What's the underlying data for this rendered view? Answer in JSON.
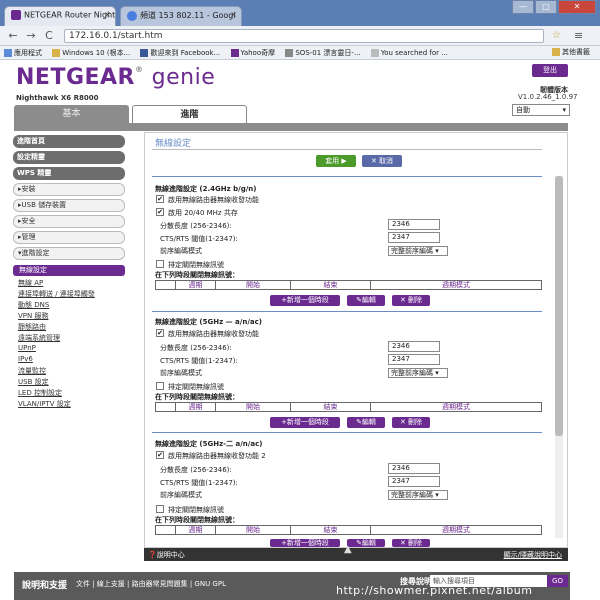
{
  "browser": {
    "tabs": [
      {
        "label": "NETGEAR Router Nighth",
        "close": "×"
      },
      {
        "label": "頻道 153 802.11 - Googl",
        "close": "×"
      }
    ],
    "url": "172.16.0.1/start.htm",
    "bookmarks": [
      "應用程式",
      "Windows 10 (根本...",
      "歡迎來到 Facebook...",
      "Yahoo奇摩",
      "SOS-01 漂言靈日-...",
      "You searched for ..."
    ],
    "bookmarks_other": "其他書籤",
    "window_controls": [
      "—",
      "□",
      "✕"
    ],
    "nav": [
      "←",
      "→",
      "C"
    ]
  },
  "header": {
    "brand": "NETGEAR",
    "genie": "genie",
    "reg": "®",
    "model": "Nighthawk X6 R8000",
    "logout": "登出",
    "firmware_label": "韌體版本",
    "firmware_version": "V1.0.2.46_1.0.97",
    "language": "自動",
    "tab_basic": "基本",
    "tab_advanced": "進階"
  },
  "sidebar": {
    "main_items": [
      "進階首頁",
      "設定精靈",
      "WPS 精靈"
    ],
    "sections": [
      "▸安裝",
      "▸USB 儲存裝置",
      "▸安全",
      "▸管理",
      "▾進階設定"
    ],
    "active": "無線設定",
    "sub_items": [
      "無線 AP",
      "連接埠轉送 / 連接埠觸發",
      "動態 DNS",
      "VPN 服務",
      "靜態路由",
      "遠端系統管理",
      "UPnP",
      "IPv6",
      "流量監控",
      "USB 設定",
      "LED 控制設定",
      "VLAN/IPTV 設定"
    ]
  },
  "main": {
    "title": "無線設定",
    "apply": "套用 ▶",
    "cancel": "✕ 取消",
    "bands": [
      {
        "title": "無線進階設定 (2.4GHz b/g/n)",
        "enable_radio": "啟用無線路由器無線收發功能",
        "coexist": "啟用 20/40 MHz 共存",
        "frag_label": "分散長度 (256-2346):",
        "frag_value": "2346",
        "rts_label": "CTS/RTS 閾值(1-2347):",
        "rts_value": "2347",
        "preamble_label": "前序編碼模式",
        "preamble_value": "完整前序編碼",
        "schedule_cb": "排定關閉無線訊號",
        "schedule_title": "在下列時段關閉無線訊號："
      },
      {
        "title": "無線進階設定 (5GHz — a/n/ac)",
        "enable_radio": "啟用無線路由器無線收發功能",
        "frag_label": "分散長度 (256-2346):",
        "frag_value": "2346",
        "rts_label": "CTS/RTS 閾值(1-2347):",
        "rts_value": "2347",
        "preamble_label": "前序編碼模式",
        "preamble_value": "完整前序編碼",
        "schedule_cb": "排定關閉無線訊號",
        "schedule_title": "在下列時段關閉無線訊號："
      },
      {
        "title": "無線進階設定 (5GHz-二 a/n/ac)",
        "enable_radio": "啟用無線路由器無線收發功能 2",
        "frag_label": "分散長度 (256-2346):",
        "frag_value": "2346",
        "rts_label": "CTS/RTS 閾值(1-2347):",
        "rts_value": "2347",
        "preamble_label": "前序編碼模式",
        "preamble_value": "完整前序編碼",
        "schedule_cb": "排定關閉無線訊號",
        "schedule_title": "在下列時段關閉無線訊號："
      }
    ],
    "schedule_columns": [
      "",
      "週期",
      "開始",
      "結束",
      "週期模式"
    ],
    "add_period": "+新增一個時段",
    "edit": "✎編輯",
    "delete": "✕ 刪除"
  },
  "helpbar": {
    "left": "說明中心",
    "right": "顯示/隱藏說明中心"
  },
  "footer": {
    "support": "說明和支援",
    "links": "文件 | 線上支援 | 路由器常見問題集 | GNU GPL",
    "search_label": "搜尋說明",
    "search_placeholder": "輸入搜尋項目",
    "go": "GO"
  },
  "watermark": "http://showmer.pixnet.net/album",
  "colors": {
    "brand": "#6b2a8f",
    "apply": "#4c9a2a"
  }
}
